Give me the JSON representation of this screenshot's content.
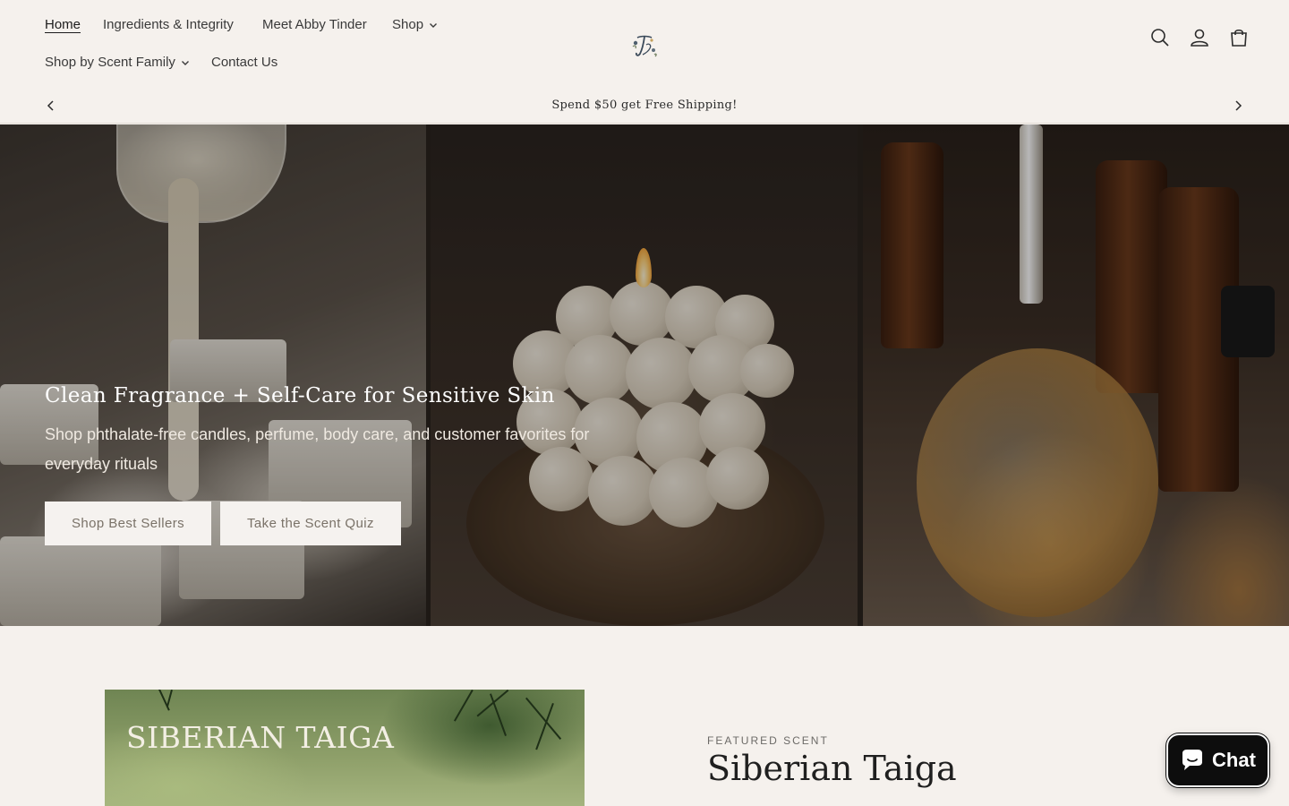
{
  "nav": {
    "items": [
      {
        "label": "Home",
        "active": true,
        "dropdown": false
      },
      {
        "label": "Ingredients & Integrity",
        "active": false,
        "dropdown": false
      },
      {
        "label": "Meet Abby Tinder",
        "active": false,
        "dropdown": false
      },
      {
        "label": "Shop",
        "active": false,
        "dropdown": true
      },
      {
        "label": "Shop by Scent Family",
        "active": false,
        "dropdown": true
      },
      {
        "label": "Contact Us",
        "active": false,
        "dropdown": false
      }
    ]
  },
  "header": {
    "logo_icon": "floral-monogram-logo",
    "icons": [
      "search-icon",
      "account-icon",
      "cart-icon"
    ]
  },
  "announcement": {
    "text": "Spend $50 get Free Shipping!"
  },
  "hero": {
    "title": "Clean Fragrance + Self-Care for Sensitive Skin",
    "subtitle": "Shop phthalate-free candles, perfume, body care, and customer favorites for everyday rituals",
    "buttons": [
      "Shop Best Sellers",
      "Take the Scent Quiz"
    ]
  },
  "featured": {
    "eyebrow": "FEATURED SCENT",
    "title": "Siberian Taiga",
    "image_text": "SIBERIAN TAIGA"
  },
  "chat": {
    "label": "Chat"
  },
  "colors": {
    "background": "#f5f1ed",
    "button_bg": "#f5f2ef",
    "chat_bg": "#0d0d0d"
  }
}
